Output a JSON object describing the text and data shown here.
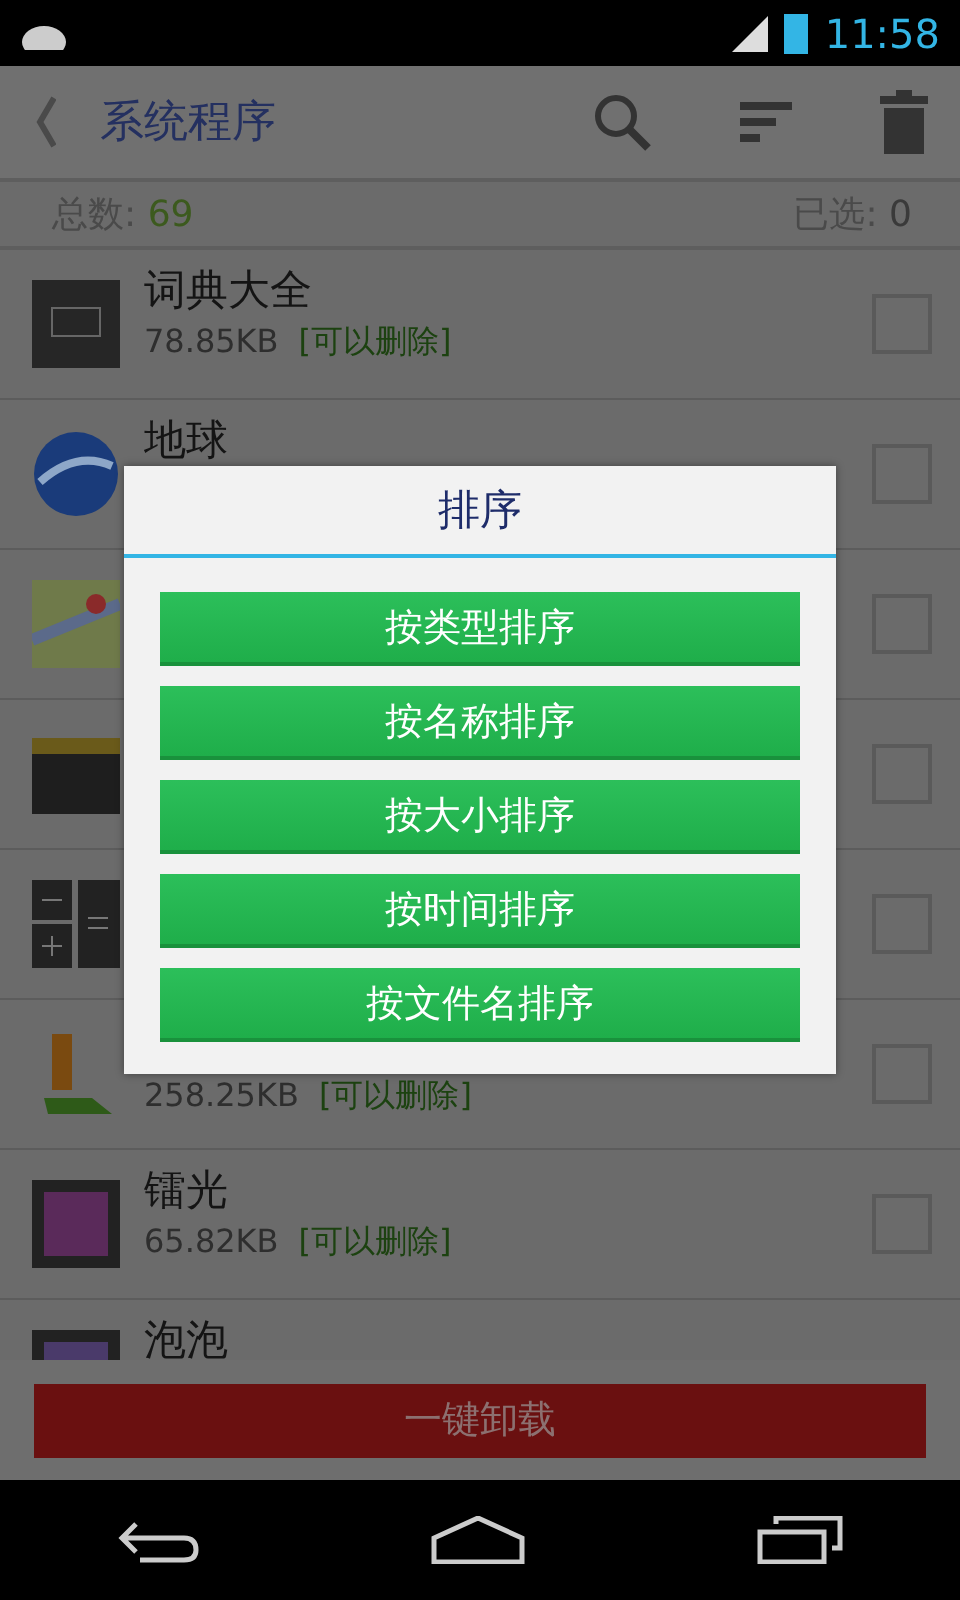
{
  "status_bar": {
    "time": "11:58"
  },
  "toolbar": {
    "title": "系统程序"
  },
  "summary": {
    "total_label": "总数:",
    "total": "69",
    "selected_label": "已选:",
    "selected": "0"
  },
  "apps": [
    {
      "name": "词典大全",
      "size": "78.85KB",
      "tag": "[可以删除]",
      "checked": false
    },
    {
      "name": "地球",
      "checked": false
    },
    {
      "checked": false
    },
    {
      "checked": false
    },
    {
      "checked": false
    },
    {
      "size": "258.25KB",
      "tag": "[可以删除]",
      "checked": false
    },
    {
      "name": "镭光",
      "size": "65.82KB",
      "tag": "[可以删除]",
      "checked": false
    },
    {
      "name": "泡泡"
    }
  ],
  "footer_button": "一键卸载",
  "dialog": {
    "title": "排序",
    "options": [
      "按类型排序",
      "按名称排序",
      "按大小排序",
      "按时间排序",
      "按文件名排序"
    ]
  }
}
